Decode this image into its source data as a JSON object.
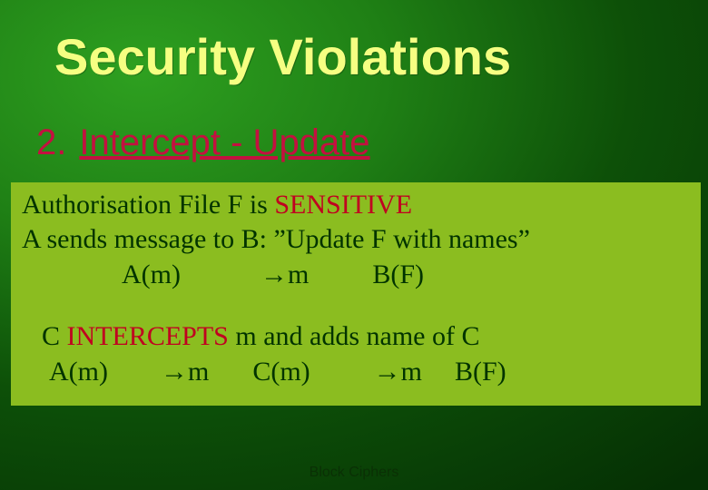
{
  "title": "Security Violations",
  "subtitle": {
    "num": "2.",
    "text": "Intercept - Update"
  },
  "box": {
    "l1a": "Authorisation File F is ",
    "l1b": "SENSITIVE",
    "l2": "A sends message to B:  ”Update F with names”",
    "l3_am": "A(m)",
    "l3_arrow_m": "m",
    "l3_bf": "B(F)",
    "l4a": "C ",
    "l4b": "INTERCEPTS",
    "l4c": " m and adds name of C",
    "l5_am": "A(m)",
    "l5_arr1_m": "m",
    "l5_cm": "C(m)",
    "l5_arr2_m": "m",
    "l5_bf": "B(F)"
  },
  "arrow": "→",
  "footer": "Block Ciphers"
}
